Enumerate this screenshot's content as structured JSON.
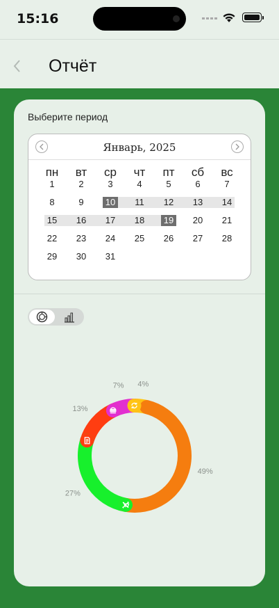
{
  "status_bar": {
    "time": "15:16"
  },
  "header": {
    "title": "Отчёт"
  },
  "period_label": "Выберите период",
  "calendar": {
    "month": "Январь, 2025",
    "weekdays": [
      "пн",
      "вт",
      "ср",
      "чт",
      "пт",
      "сб",
      "вс"
    ],
    "weeks": [
      [
        "1",
        "2",
        "3",
        "4",
        "5",
        "6",
        "7"
      ],
      [
        "8",
        "9",
        "10",
        "11",
        "12",
        "13",
        "14"
      ],
      [
        "15",
        "16",
        "17",
        "18",
        "19",
        "20",
        "21"
      ],
      [
        "22",
        "23",
        "24",
        "25",
        "26",
        "27",
        "28"
      ],
      [
        "29",
        "30",
        "31",
        "",
        "",
        "",
        ""
      ]
    ],
    "range_start": "10",
    "range_end": "19"
  },
  "view_toggle": {
    "selected": "donut",
    "options": [
      "donut-chart-icon",
      "bar-chart-icon"
    ]
  },
  "chart_data": {
    "type": "pie",
    "variant": "donut",
    "slices": [
      {
        "percent": 49,
        "label": "49%",
        "color": "#f57d0f",
        "icon": "cart-icon"
      },
      {
        "percent": 27,
        "label": "27%",
        "color": "#17f02c",
        "icon": "tools-icon"
      },
      {
        "percent": 13,
        "label": "13%",
        "color": "#ff3d11",
        "icon": "document-icon"
      },
      {
        "percent": 7,
        "label": "7%",
        "color": "#e22fd0",
        "icon": "food-icon"
      },
      {
        "percent": 4,
        "label": "4%",
        "color": "#ffc414",
        "icon": "refresh-icon"
      }
    ]
  }
}
